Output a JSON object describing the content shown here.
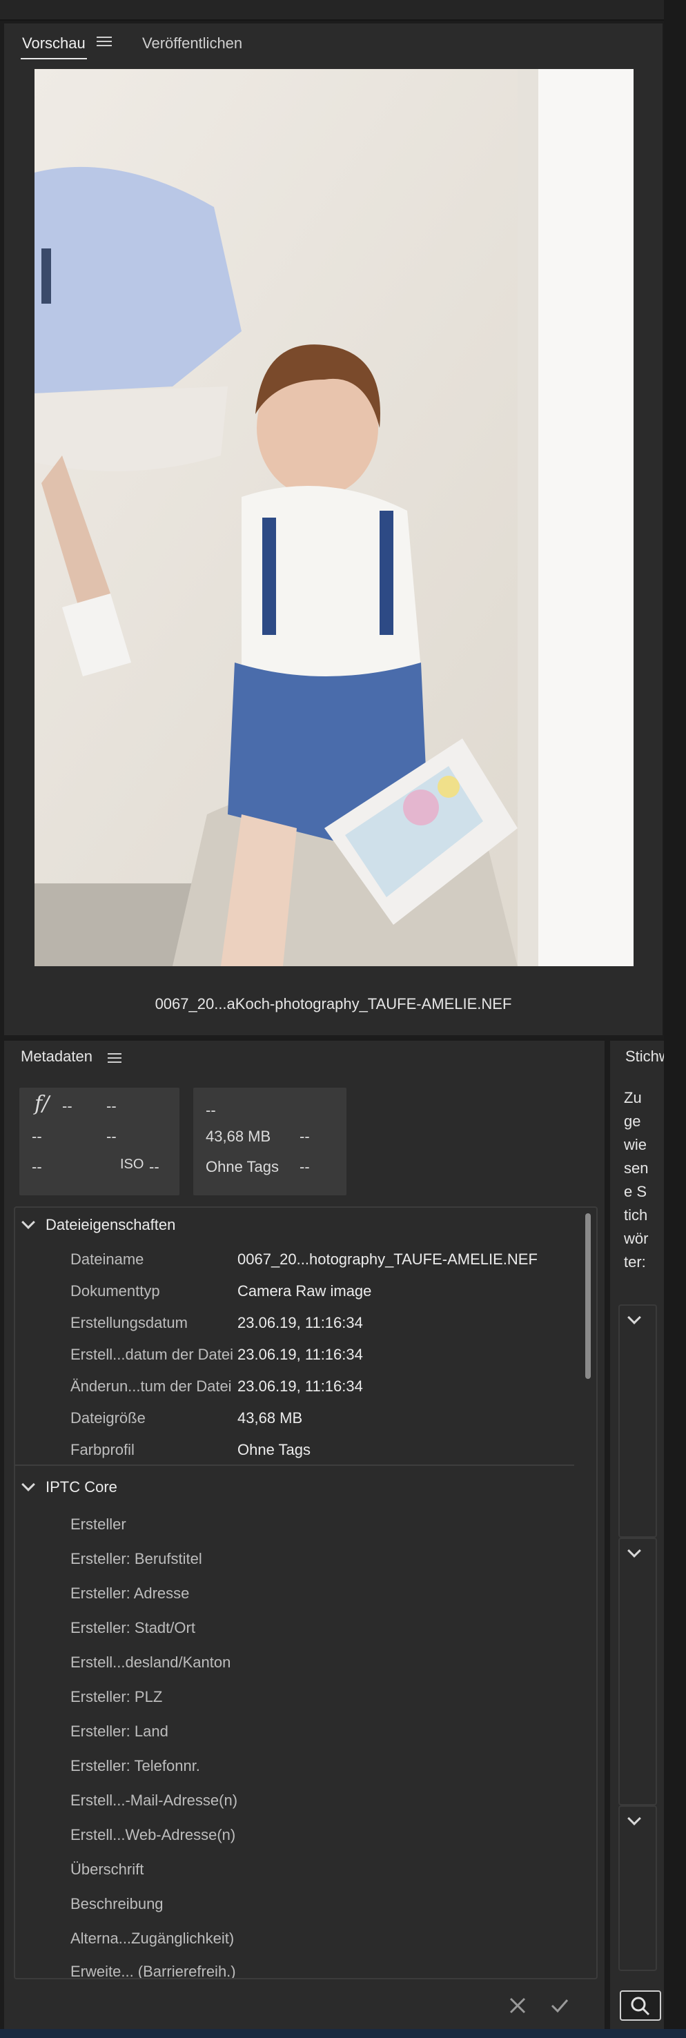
{
  "tabs": {
    "preview": "Vorschau",
    "publish": "Veröffentlichen"
  },
  "preview": {
    "filename": "0067_20...aKoch-photography_TAUFE-AMELIE.NEF"
  },
  "metadata": {
    "title": "Metadaten",
    "summary": {
      "fstop_icon": "f/",
      "aperture": "--",
      "shutter": "--",
      "c1r2": "--",
      "c2r2": "--",
      "c1r3": "--",
      "iso_label": "ISO",
      "iso_value": "--",
      "right_top": "--",
      "size": "43,68 MB",
      "size_extra": "--",
      "profile": "Ohne Tags",
      "profile_extra": "--"
    },
    "file_properties": {
      "title": "Dateieigenschaften",
      "rows": [
        {
          "label": "Dateiname",
          "value": "0067_20...hotography_TAUFE-AMELIE.NEF"
        },
        {
          "label": "Dokumenttyp",
          "value": "Camera Raw image"
        },
        {
          "label": "Erstellungsdatum",
          "value": "23.06.19, 11:16:34"
        },
        {
          "label": "Erstell...datum der Datei",
          "value": "23.06.19, 11:16:34"
        },
        {
          "label": "Änderun...tum der Datei",
          "value": "23.06.19, 11:16:34"
        },
        {
          "label": "Dateigröße",
          "value": "43,68 MB"
        },
        {
          "label": "Farbprofil",
          "value": "Ohne Tags"
        }
      ]
    },
    "iptc": {
      "title": "IPTC Core",
      "rows": [
        "Ersteller",
        "Ersteller: Berufstitel",
        "Ersteller: Adresse",
        "Ersteller: Stadt/Ort",
        "Erstell...desland/Kanton",
        "Ersteller: PLZ",
        "Ersteller: Land",
        "Ersteller: Telefonnr.",
        "Erstell...-Mail-Adresse(n)",
        "Erstell...Web-Adresse(n)",
        "Überschrift",
        "Beschreibung",
        "Alterna...Zugänglichkeit)",
        "Erweite... (Barrierefreih.)"
      ]
    }
  },
  "keywords": {
    "title": "Stichwörter",
    "assigned": "Zugewiesene Stichwörter:"
  },
  "icons": {
    "menu": "hamburger-icon",
    "cancel": "close-icon",
    "confirm": "checkmark-icon",
    "search": "search-icon"
  }
}
